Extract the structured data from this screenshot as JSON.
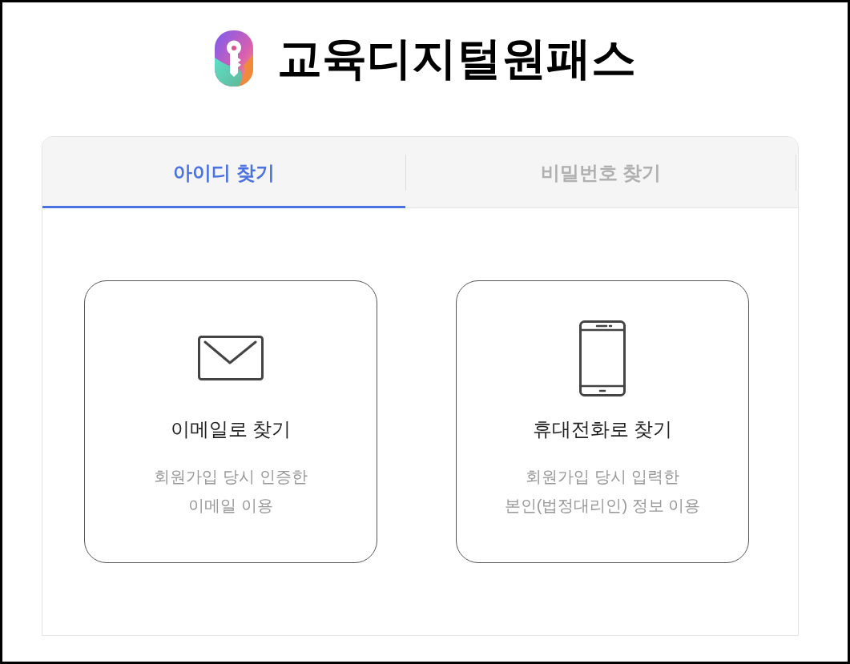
{
  "header": {
    "title": "교육디지털원패스"
  },
  "tabs": [
    {
      "label": "아이디 찾기",
      "selected": true
    },
    {
      "label": "비밀번호 찾기",
      "selected": false
    }
  ],
  "options": [
    {
      "kind": "email",
      "title": "이메일로 찾기",
      "description_lines": [
        "회원가입 당시 인증한",
        "이메일 이용"
      ]
    },
    {
      "kind": "phone",
      "title": "휴대전화로 찾기",
      "description_lines": [
        "회원가입 당시 입력한",
        "본인(법정대리인) 정보 이용"
      ]
    }
  ]
}
